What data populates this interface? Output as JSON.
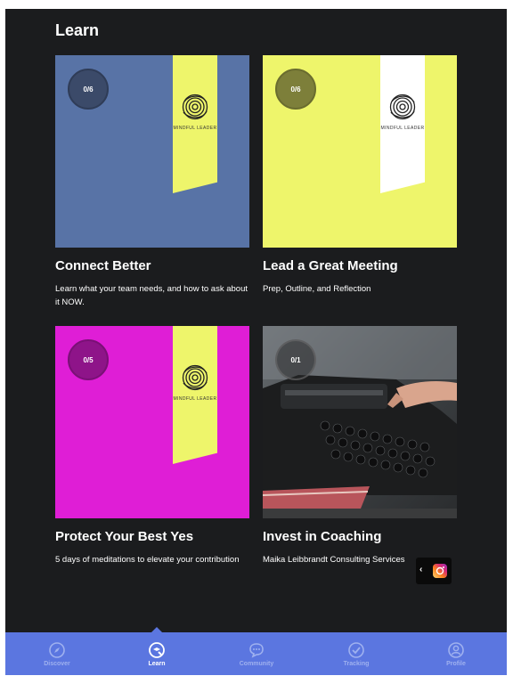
{
  "header": {
    "title": "Learn"
  },
  "cards": [
    {
      "title": "Connect Better",
      "description": "Learn what your team needs, and how to ask about it NOW.",
      "progress": "0/6",
      "bg_color": "#5873a6",
      "bookmark_color": "#eef56b",
      "brand": "MINDFUL LEADER"
    },
    {
      "title": "Lead a Great Meeting",
      "description": "Prep, Outline, and Reflection",
      "progress": "0/6",
      "bg_color": "#eef56b",
      "bookmark_color": "#ffffff",
      "brand": "MINDFUL LEADER"
    },
    {
      "title": "Protect Your Best Yes",
      "description": "5 days of meditations to elevate your contribution",
      "progress": "0/5",
      "bg_color": "#df1ed6",
      "bookmark_color": "#eef56b",
      "brand": "MINDFUL LEADER"
    },
    {
      "title": "Invest in Coaching",
      "description": "Maika Leibbrandt Consulting Services",
      "progress": "0/1",
      "image": "typewriter-photo"
    }
  ],
  "nav": {
    "items": [
      {
        "label": "Discover",
        "icon": "compass-icon"
      },
      {
        "label": "Learn",
        "icon": "learn-icon"
      },
      {
        "label": "Community",
        "icon": "chat-icon"
      },
      {
        "label": "Tracking",
        "icon": "check-circle-icon"
      },
      {
        "label": "Profile",
        "icon": "person-icon"
      }
    ],
    "active": "Learn",
    "bg_color": "#5b76e0"
  },
  "floating": {
    "icon": "instagram-icon"
  }
}
